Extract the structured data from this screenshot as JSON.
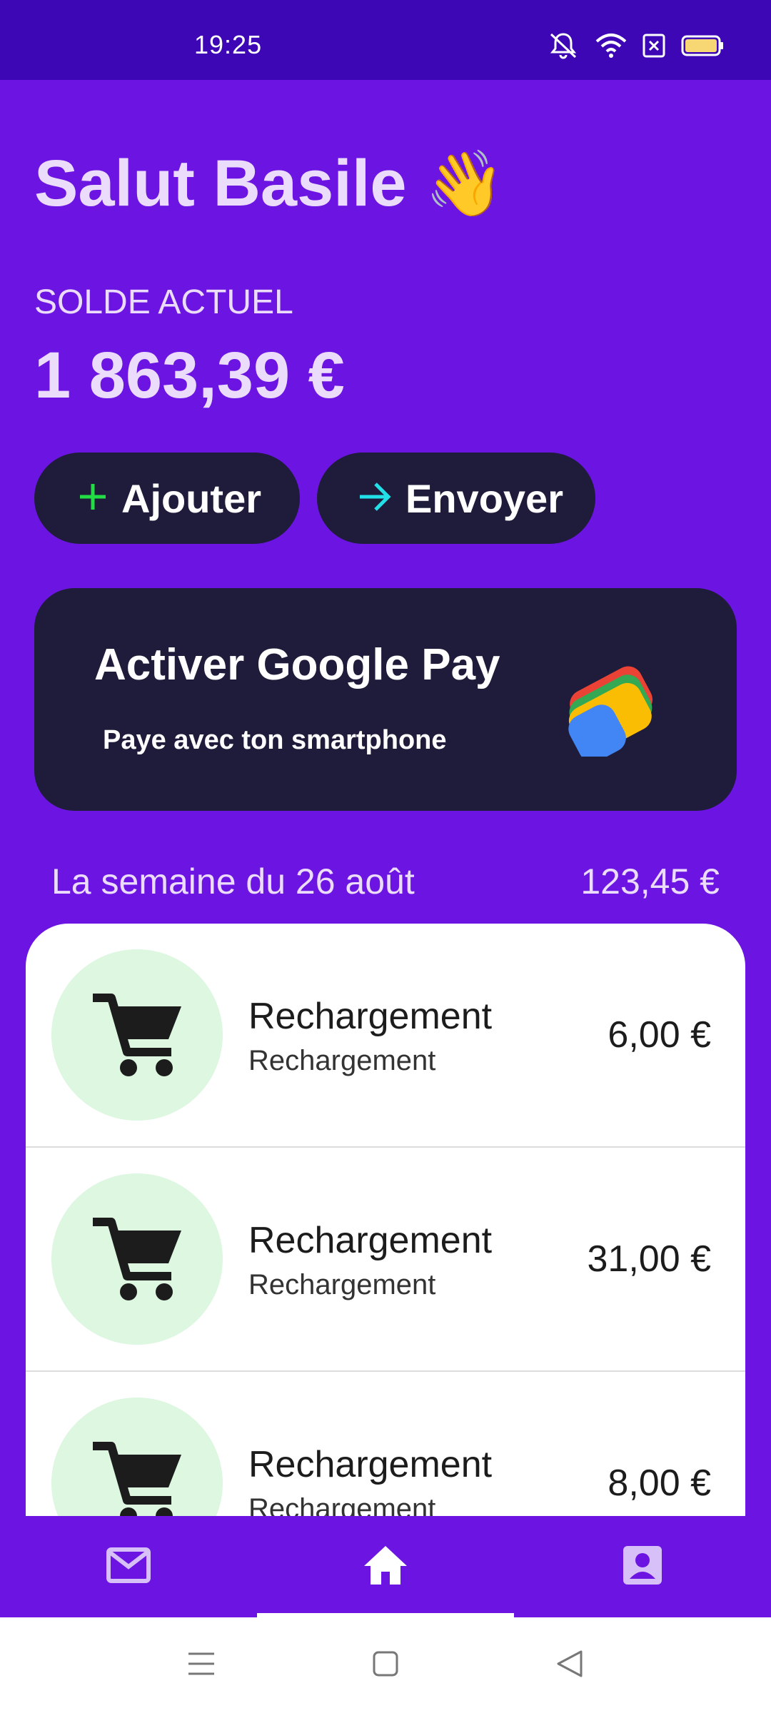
{
  "status_bar": {
    "time": "19:25",
    "icons": [
      "bell-mute-icon",
      "wifi-icon",
      "sim-x-icon",
      "battery-icon"
    ],
    "background": "#3d07b5"
  },
  "greeting": {
    "text": "Salut Basile",
    "emoji": "👋"
  },
  "balance": {
    "label": "SOLDE ACTUEL",
    "value": "1 863,39 €"
  },
  "actions": {
    "add_label": "Ajouter",
    "add_icon": "plus-icon",
    "send_label": "Envoyer",
    "send_icon": "arrow-right-icon"
  },
  "gpay_card": {
    "title": "Activer Google Pay",
    "subtitle": "Paye avec ton smartphone",
    "icon": "google-pay-logo"
  },
  "week": {
    "label": "La semaine du 26 août",
    "total": "123,45 €"
  },
  "transactions": [
    {
      "title": "Rechargement",
      "subtitle": "Rechargement",
      "amount": "6,00 €",
      "icon": "cart-icon"
    },
    {
      "title": "Rechargement",
      "subtitle": "Rechargement",
      "amount": "31,00 €",
      "icon": "cart-icon"
    },
    {
      "title": "Rechargement",
      "subtitle": "Rechargement",
      "amount": "8,00 €",
      "icon": "cart-icon"
    }
  ],
  "bottom_nav": {
    "items": [
      {
        "icon": "mail-icon",
        "active": false
      },
      {
        "icon": "home-icon",
        "active": true
      },
      {
        "icon": "profile-icon",
        "active": false
      }
    ]
  },
  "system_nav": {
    "icons": [
      "menu-icon",
      "square-icon",
      "back-triangle-icon"
    ]
  },
  "colors": {
    "primary": "#6c15e3",
    "card_dark": "#1e1c3a",
    "text_light": "#ecdcfb",
    "plus_green": "#22dd44",
    "arrow_cyan": "#22e0e8",
    "avatar_bg": "#ddf7e1"
  }
}
